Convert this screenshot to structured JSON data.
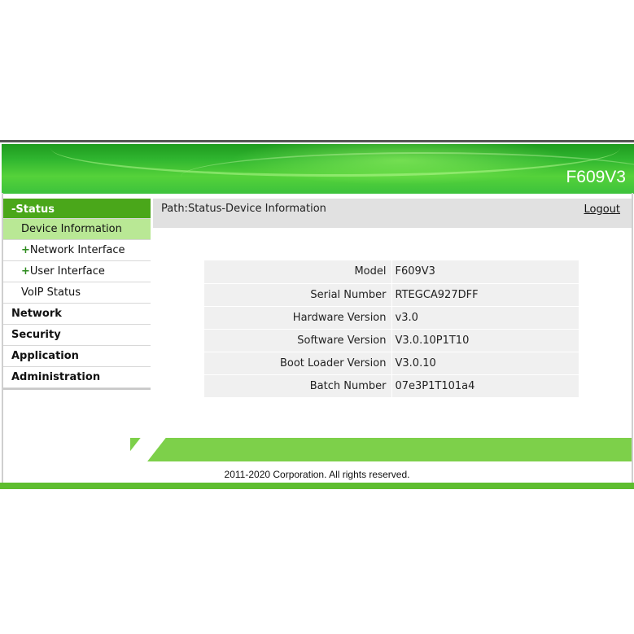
{
  "header": {
    "model": "F609V3"
  },
  "sidebar": {
    "status_label": "-Status",
    "items": [
      {
        "label": "Device Information",
        "prefix": ""
      },
      {
        "label": "Network Interface",
        "prefix": "+"
      },
      {
        "label": "User Interface",
        "prefix": "+"
      },
      {
        "label": "VoIP Status",
        "prefix": ""
      }
    ],
    "sections": [
      "Network",
      "Security",
      "Application",
      "Administration"
    ]
  },
  "pathbar": {
    "path": "Path:Status-Device Information",
    "logout": "Logout"
  },
  "device_info": {
    "rows": [
      {
        "label": "Model",
        "value": "F609V3"
      },
      {
        "label": "Serial Number",
        "value": "RTEGCA927DFF"
      },
      {
        "label": "Hardware Version",
        "value": "v3.0"
      },
      {
        "label": "Software Version",
        "value": "V3.0.10P1T10"
      },
      {
        "label": "Boot Loader Version",
        "value": "V3.0.10"
      },
      {
        "label": "Batch Number",
        "value": "07e3P1T101a4"
      }
    ]
  },
  "footer": {
    "copyright": "2011-2020 Corporation. All rights reserved."
  },
  "colors": {
    "accent": "#4aa71a",
    "selected": "#b9e895",
    "footer_bar": "#7dd04a"
  }
}
